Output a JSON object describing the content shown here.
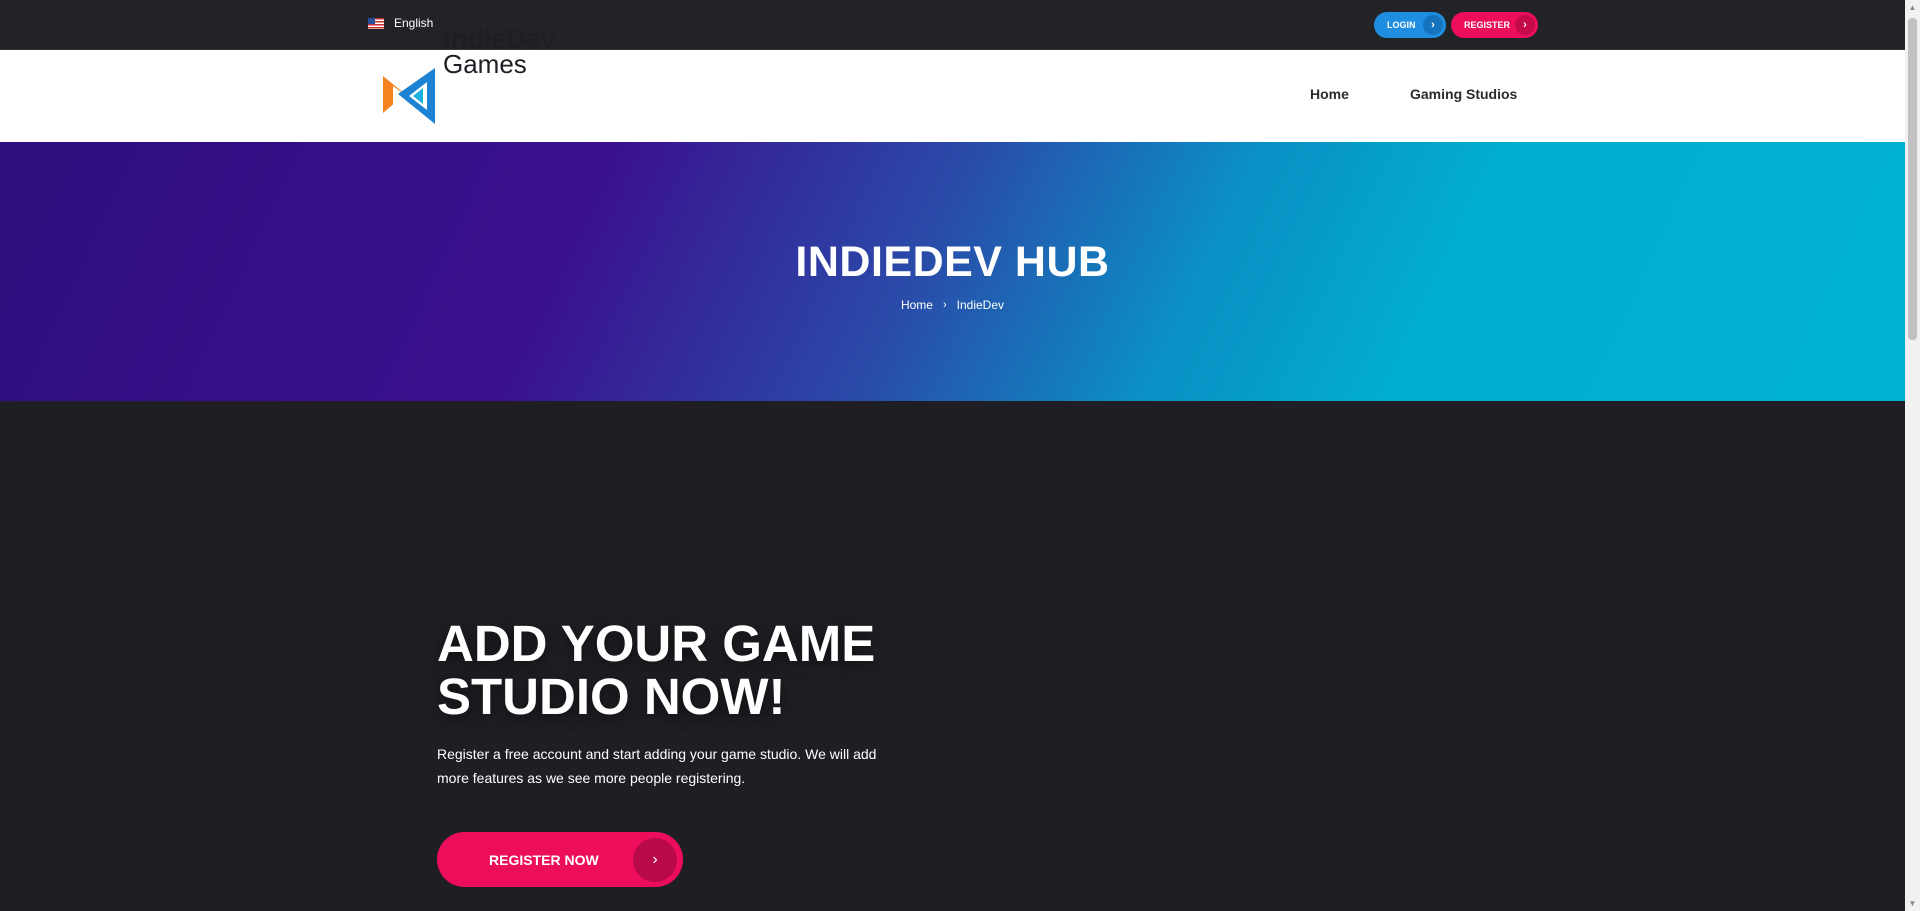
{
  "topbar": {
    "language": "English",
    "login_label": "LOGIN",
    "register_label": "REGISTER",
    "arrow": "›"
  },
  "navbar": {
    "logo_line1": "IndieDev",
    "logo_line2": "Games",
    "links": [
      {
        "label": "Home"
      },
      {
        "label": "Gaming Studios"
      }
    ]
  },
  "hero": {
    "title": "INDIEDEV HUB",
    "breadcrumb": [
      "Home",
      "IndieDev"
    ],
    "breadcrumb_separator": "›"
  },
  "main": {
    "title": "ADD YOUR GAME STUDIO NOW!",
    "description": "Register a free account and start adding your game studio. We will add more features as we see more people registering.",
    "cta_label": "REGISTER NOW",
    "cta_arrow": "›"
  },
  "colors": {
    "accent_pink": "#ec0e5a",
    "accent_blue": "#1f8de0",
    "dark_bg": "#1e1e24",
    "logo_orange": "#f4821f",
    "logo_blue": "#1c82d4"
  },
  "icons": {
    "flag": "us-flag-icon",
    "login_arrow": "chevron-right-icon",
    "register_arrow": "chevron-right-icon",
    "breadcrumb_separator": "chevron-right-icon",
    "cta_arrow": "chevron-right-icon"
  }
}
